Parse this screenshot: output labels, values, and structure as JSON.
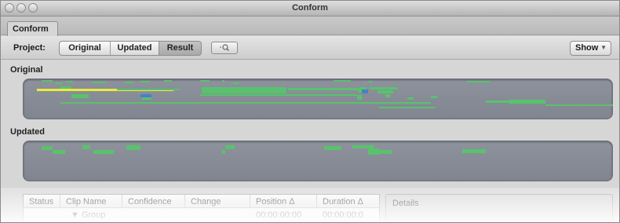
{
  "window": {
    "title": "Conform"
  },
  "tabs": [
    {
      "label": "Conform"
    }
  ],
  "project_bar": {
    "label": "Project:",
    "segments": [
      {
        "label": "Original",
        "selected": false
      },
      {
        "label": "Updated",
        "selected": false
      },
      {
        "label": "Result",
        "selected": true
      }
    ],
    "show_label": "Show"
  },
  "sections": {
    "original": {
      "label": "Original"
    },
    "updated": {
      "label": "Updated"
    }
  },
  "table": {
    "columns": [
      "Status",
      "Clip Name",
      "Confidence",
      "Change",
      "Position Δ",
      "Duration Δ"
    ],
    "rows": [
      {
        "status": "",
        "clip_name": "▼ Group",
        "confidence": "",
        "change": "",
        "position": "00:00:00:00",
        "duration": "00:00:00:0"
      }
    ]
  },
  "details": {
    "label": "Details"
  },
  "colors": {
    "clip": "#59c26d",
    "highlight": "#e8ec3a",
    "track": "#878c96"
  },
  "icons": {
    "zoom": "magnifier-icon",
    "show_dropdown": "chevron-down-icon"
  }
}
